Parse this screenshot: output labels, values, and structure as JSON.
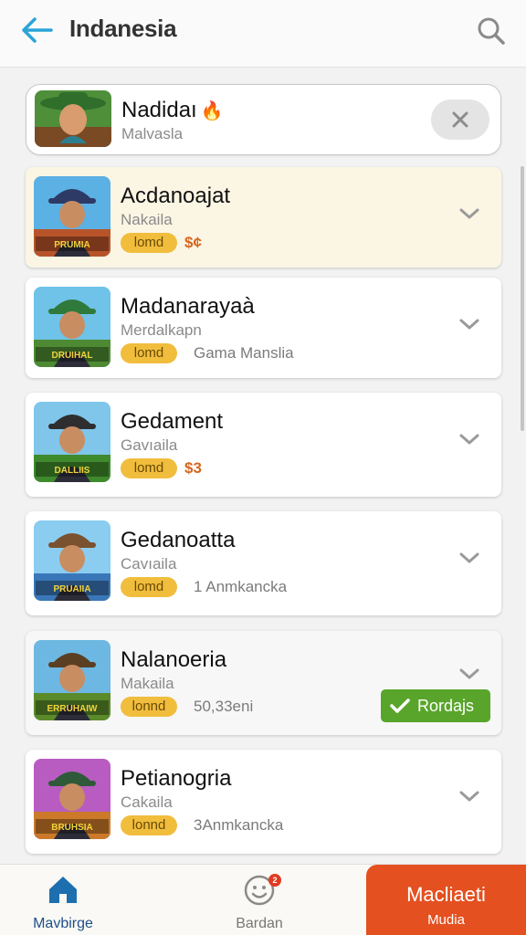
{
  "header": {
    "title": "Indanesia"
  },
  "featured": {
    "name": "Nadidaı",
    "subtitle": "Malvasla"
  },
  "games": [
    {
      "name": "Acdanoajat",
      "subtitle": "Nakaila",
      "badge": "lomd",
      "extra": "$¢",
      "extra_style": "price",
      "thumb_text": "PRUMIA"
    },
    {
      "name": "Madanarayaà",
      "subtitle": "Merdalkapn",
      "badge": "lomd",
      "extra": "Gama Manslia",
      "extra_style": "info",
      "thumb_text": "DRUIHAL"
    },
    {
      "name": "Gedament",
      "subtitle": "Gavıaila",
      "badge": "lomd",
      "extra": "$3",
      "extra_style": "price",
      "thumb_text": "DALLIIS"
    },
    {
      "name": "Gedanoatta",
      "subtitle": "Cavıaila",
      "badge": "lomd",
      "extra": "1 Anmkancka",
      "extra_style": "info",
      "thumb_text": "PRUAIIA"
    },
    {
      "name": "Nalanoeria",
      "subtitle": "Makaila",
      "badge": "lonnd",
      "extra": "50,33eni",
      "extra_style": "info",
      "thumb_text": "ERRUHAIW"
    },
    {
      "name": "Petianogria",
      "subtitle": "Cakaila",
      "badge": "lonnd",
      "extra": "3Anmkancka",
      "extra_style": "info",
      "thumb_text": "BRUHSIA"
    }
  ],
  "done_button": {
    "label": "Rordajs"
  },
  "tabbar": {
    "home_label": "Mavbirge",
    "bardan_label": "Bardan",
    "notification_count": "2",
    "cta_title": "Macliaeti",
    "cta_subtitle": "Mudia"
  },
  "colors": {
    "accent_blue": "#2aa4d8",
    "badge_yellow": "#f1bd3d",
    "success_green": "#59a52b",
    "cta_orange": "#e4501f"
  },
  "icons": [
    "back-arrow-icon",
    "search-icon",
    "close-icon",
    "chevron-down-icon",
    "checkmark-icon",
    "home-icon",
    "smiley-icon"
  ]
}
